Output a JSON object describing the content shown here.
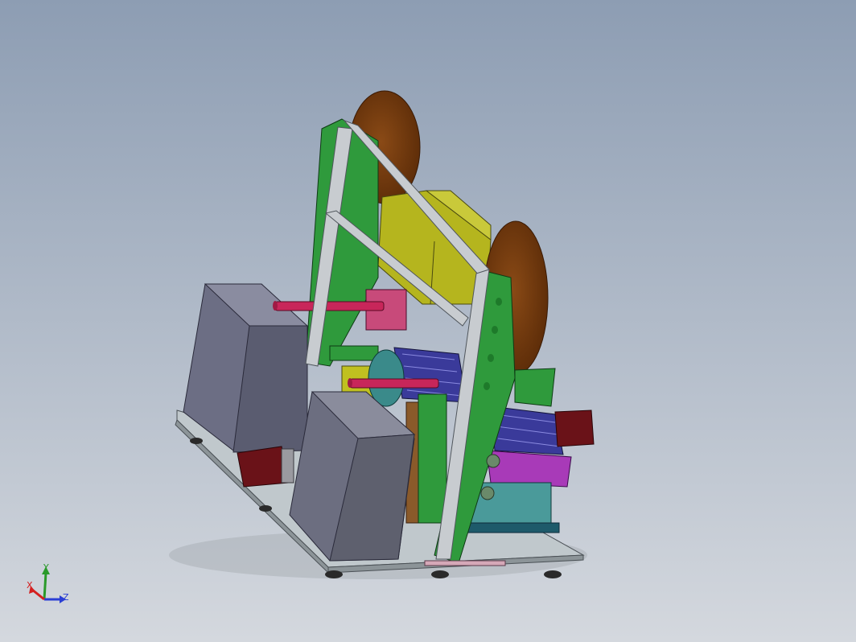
{
  "viewport": {
    "background_top": "#8d9db3",
    "background_bottom": "#d4d8de"
  },
  "triad": {
    "x_label": "X",
    "y_label": "Y",
    "z_label": "Z",
    "x_color": "#d42020",
    "y_color": "#2a9a2a",
    "z_color": "#2a3ed4"
  },
  "model": {
    "colors": {
      "base_plate": "#b9c2c8",
      "frame_green": "#2e9a3a",
      "extrusion": "#c8ccd0",
      "reel": "#7a3c0c",
      "yellow_block": "#b8b81a",
      "cabinet": "#6c6e84",
      "shaft": "#c8265a",
      "motor": "#6a1218",
      "tray": "#3a3a9a",
      "purple": "#9a3ab8"
    }
  }
}
